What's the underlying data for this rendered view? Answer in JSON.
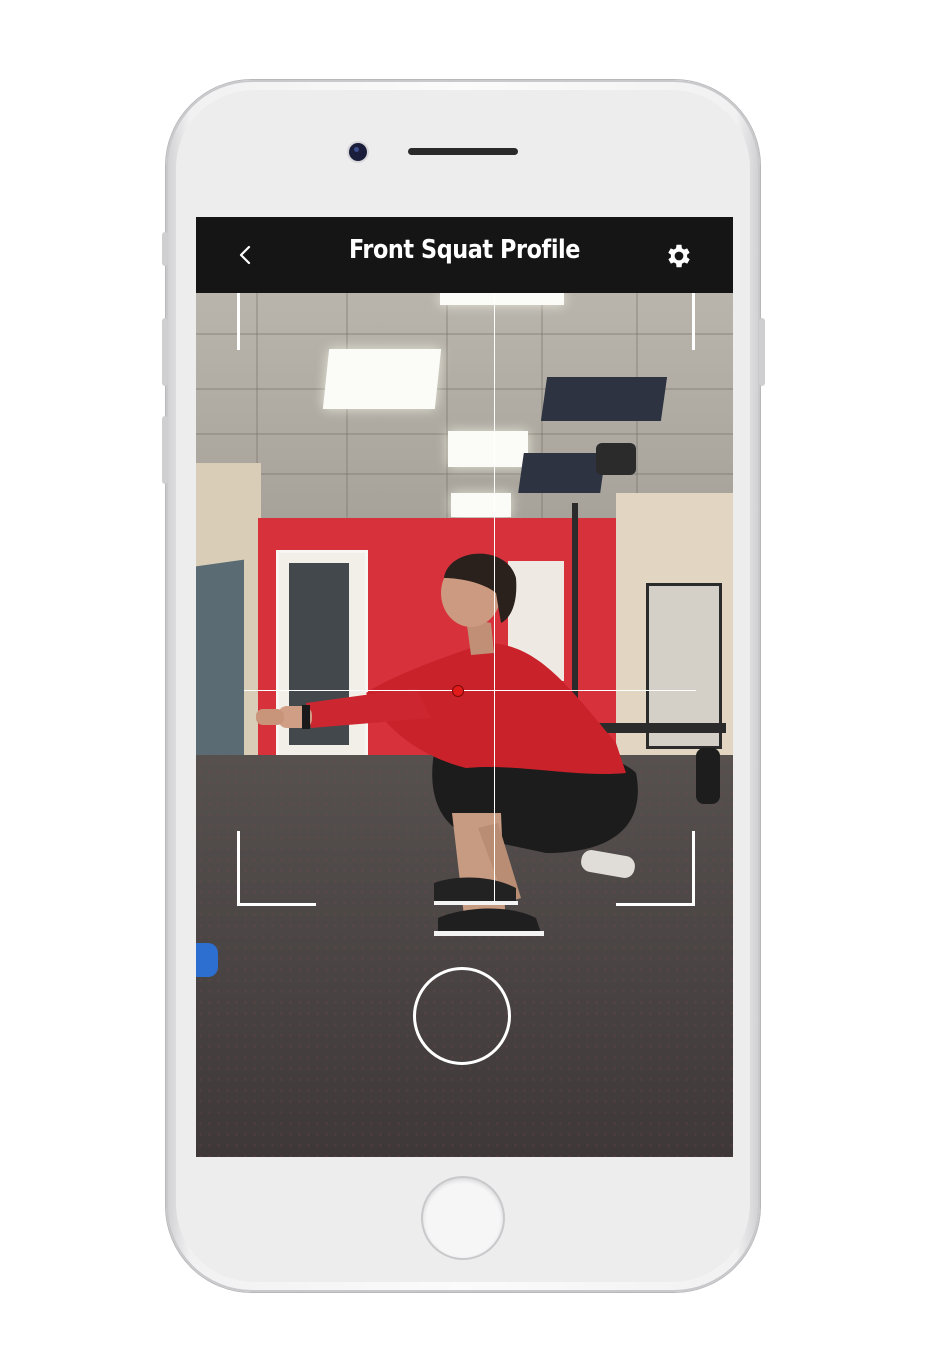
{
  "navbar": {
    "title": "Front Squat Profile",
    "back_icon": "chevron-left-icon",
    "settings_icon": "gear-icon"
  },
  "camera_view": {
    "shutter_icon": "shutter-ring-icon",
    "accent_marker_color": "#e21a1a"
  },
  "colors": {
    "navbar_bg": "#151515",
    "navbar_text": "#ffffff",
    "overlay_lines": "#ffffff"
  }
}
